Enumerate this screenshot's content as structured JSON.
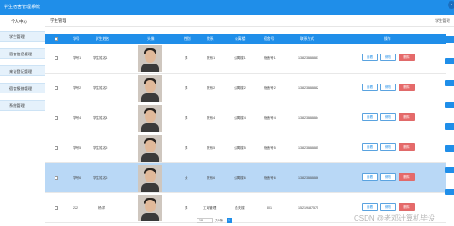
{
  "app": {
    "title": "学生宿舍管理系统",
    "top_icon_glyph": "·"
  },
  "sidebar": {
    "user_label": "个人中心",
    "items": [
      {
        "label": "学生管理"
      },
      {
        "label": "宿舍信息管理"
      },
      {
        "label": "来访登记管理"
      },
      {
        "label": "宿舍报修管理"
      },
      {
        "label": "系统管理"
      }
    ]
  },
  "tabs": {
    "active": "学生管理",
    "right": "学生管理"
  },
  "table": {
    "headers": [
      "学号",
      "学生姓名",
      "头像",
      "性别",
      "院系",
      "公寓楼",
      "宿舍号",
      "联系方式",
      "操作"
    ],
    "rows": [
      {
        "id": "学号1",
        "name": "学生姓名1",
        "gender": "男",
        "dept": "院系1",
        "building": "公寓楼1",
        "room": "宿舍号1",
        "phone": "13823888881",
        "selected": false
      },
      {
        "id": "学号2",
        "name": "学生姓名2",
        "gender": "男",
        "dept": "院系2",
        "building": "公寓楼2",
        "room": "宿舍号2",
        "phone": "13823888882",
        "selected": false
      },
      {
        "id": "学号4",
        "name": "学生姓名4",
        "gender": "男",
        "dept": "院系4",
        "building": "公寓楼4",
        "room": "宿舍号4",
        "phone": "13823888884",
        "selected": false
      },
      {
        "id": "学号5",
        "name": "学生姓名5",
        "gender": "男",
        "dept": "院系5",
        "building": "公寓楼5",
        "room": "宿舍号5",
        "phone": "13823888885",
        "selected": false
      },
      {
        "id": "学号6",
        "name": "学生姓名6",
        "gender": "女",
        "dept": "院系6",
        "building": "公寓楼6",
        "room": "宿舍号6",
        "phone": "13823888886",
        "selected": true
      },
      {
        "id": "222",
        "name": "杨洋",
        "gender": "男",
        "dept": "工商管理",
        "building": "逸夫楼",
        "room": "301",
        "phone": "15219187575",
        "selected": false
      }
    ],
    "actions": {
      "view": "查看",
      "edit": "修改",
      "delete": "删除"
    }
  },
  "pager": {
    "per_page": "10",
    "text": "共6条",
    "current": "1"
  },
  "watermark": "CSDN @老邓计算机毕设",
  "colors": {
    "primary": "#1f8ee9",
    "selected_row": "#b9d8f6",
    "danger": "#e66a6a"
  }
}
